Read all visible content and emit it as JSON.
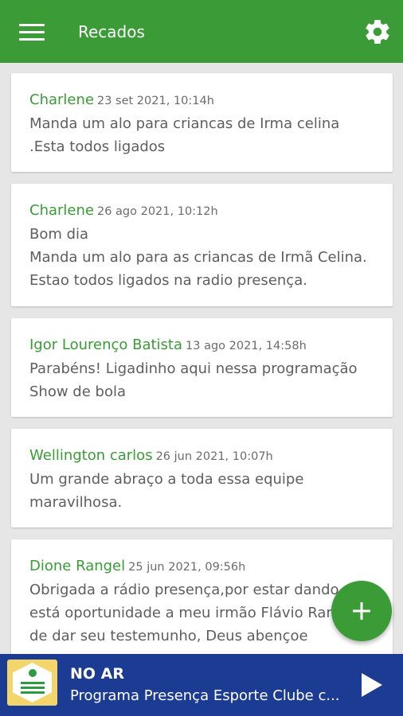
{
  "app_bar": {
    "title": "Recados",
    "menu_icon": "hamburger-menu-icon",
    "settings_icon": "gear-icon"
  },
  "messages": [
    {
      "author": "Charlene",
      "date": "23 set 2021, 10:14h",
      "text": "Manda um alo para criancas de Irma celina\n.Esta todos ligados"
    },
    {
      "author": "Charlene",
      "date": "26 ago 2021, 10:12h",
      "text": "Bom dia\nManda um alo para as criancas de Irmã Celina.\nEstao todos ligados na radio presença."
    },
    {
      "author": "Igor Lourenço Batista",
      "date": "13 ago 2021, 14:58h",
      "text": "Parabéns! Ligadinho aqui nessa programação\nShow de bola"
    },
    {
      "author": "Wellington carlos",
      "date": "26 jun 2021, 10:07h",
      "text": "Um grande abraço a toda essa equipe\nmaravilhosa."
    },
    {
      "author": "Dione Rangel",
      "date": "25 jun 2021, 09:56h",
      "text": "Obrigada a rádio presença,por estar dando\nestá oportunidade a meu irmão Flávio Rangel\nde dar seu testemunho, Deus abençoe"
    }
  ],
  "fab": {
    "icon": "plus-icon"
  },
  "player": {
    "status": "NO AR",
    "program": "Programa Presença Esporte Clube c...",
    "play_icon": "play-icon",
    "colors": {
      "background": "#1c3c94"
    }
  },
  "colors": {
    "primary": "#3a9b37",
    "background": "#e6e6e6"
  }
}
